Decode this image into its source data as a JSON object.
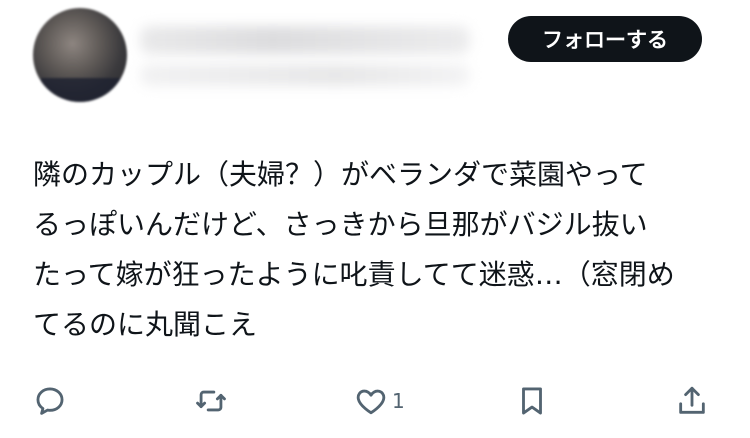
{
  "header": {
    "follow_label": "フォローする"
  },
  "tweet": {
    "text": "隣のカップル（夫婦？）がベランダで菜園やって\nるっぽいんだけど、さっきから旦那がバジル抜い\nたって嫁が狂ったように叱責してて迷惑…（窓閉め\nてるのに丸聞こえ"
  },
  "actions": {
    "reply_icon": "reply-icon",
    "retweet_icon": "retweet-icon",
    "like_icon": "heart-icon",
    "like_count": "1",
    "bookmark_icon": "bookmark-icon",
    "share_icon": "share-icon"
  },
  "colors": {
    "follow_bg": "#0f1419",
    "text": "#0f1419",
    "icon": "#536471"
  }
}
